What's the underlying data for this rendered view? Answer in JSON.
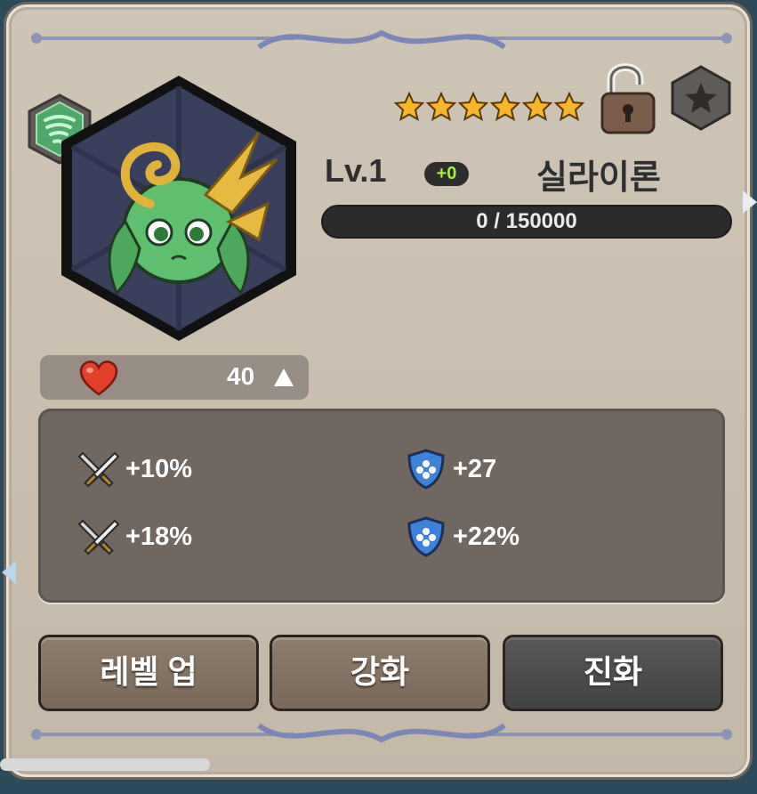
{
  "character": {
    "level_label": "Lv.1",
    "plus_label": "+0",
    "name": "실라이론",
    "star_count": 6,
    "exp_text": "0 / 150000",
    "exp_progress": 0
  },
  "affection": {
    "value": "40",
    "icon": "heart-icon",
    "trend_icon": "up-arrow-icon"
  },
  "stats": [
    {
      "icon": "crossed-swords-icon",
      "value": "+10%"
    },
    {
      "icon": "shield-icon",
      "value": "+27"
    },
    {
      "icon": "crossed-swords-icon",
      "value": "+18%"
    },
    {
      "icon": "shield-icon",
      "value": "+22%"
    }
  ],
  "buttons": {
    "level_up": "레벨 업",
    "enhance": "강화",
    "evolve": "진화"
  },
  "colors": {
    "exp_bar": "#2b2b2b",
    "plus_badge_text": "#a6f03a",
    "star": "#f5b62a",
    "shield": "#3b82d8"
  }
}
